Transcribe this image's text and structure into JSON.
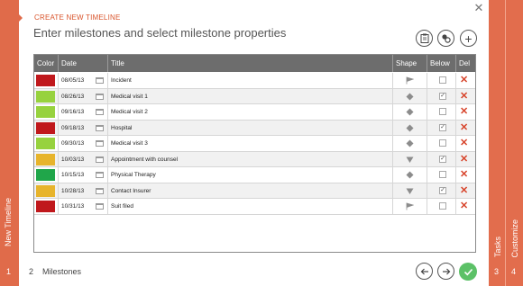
{
  "steps": {
    "left": {
      "label": "New Timeline",
      "num": "1"
    },
    "right": [
      {
        "label": "Tasks",
        "num": "3"
      },
      {
        "label": "Customize",
        "num": "4"
      }
    ]
  },
  "header": {
    "small": "CREATE NEW TIMELINE",
    "title": "Enter milestones and select milestone properties"
  },
  "toolbar": {
    "icons": [
      "clipboard-icon",
      "merge-icon",
      "add-icon"
    ],
    "add_label": "+"
  },
  "columns": [
    "Color",
    "Date",
    "Title",
    "Shape",
    "Below",
    "Del"
  ],
  "milestones": [
    {
      "color": "#c0181c",
      "date": "08/05/13",
      "title": "Incident",
      "shape": "flag",
      "below": false
    },
    {
      "color": "#97d23e",
      "date": "08/26/13",
      "title": "Medical visit 1",
      "shape": "diamond",
      "below": true
    },
    {
      "color": "#97d23e",
      "date": "09/16/13",
      "title": "Medical visit 2",
      "shape": "diamond",
      "below": false
    },
    {
      "color": "#c0181c",
      "date": "09/18/13",
      "title": "Hospital",
      "shape": "diamond",
      "below": true
    },
    {
      "color": "#97d23e",
      "date": "09/30/13",
      "title": "Medical visit 3",
      "shape": "diamond",
      "below": false
    },
    {
      "color": "#e7b42c",
      "date": "10/03/13",
      "title": "Appointment with counsel",
      "shape": "triangle-down",
      "below": true
    },
    {
      "color": "#20a64a",
      "date": "10/15/13",
      "title": "Physical Therapy",
      "shape": "diamond",
      "below": false
    },
    {
      "color": "#e7b42c",
      "date": "10/28/13",
      "title": "Contact Insurer",
      "shape": "triangle-down",
      "below": true
    },
    {
      "color": "#c0181c",
      "date": "10/31/13",
      "title": "Suit filed",
      "shape": "flag",
      "below": false
    }
  ],
  "footer": {
    "step": "2",
    "label": "Milestones"
  },
  "colors": {
    "accent": "#e06b4a",
    "delete": "#d7432a",
    "ok": "#5cc167"
  }
}
